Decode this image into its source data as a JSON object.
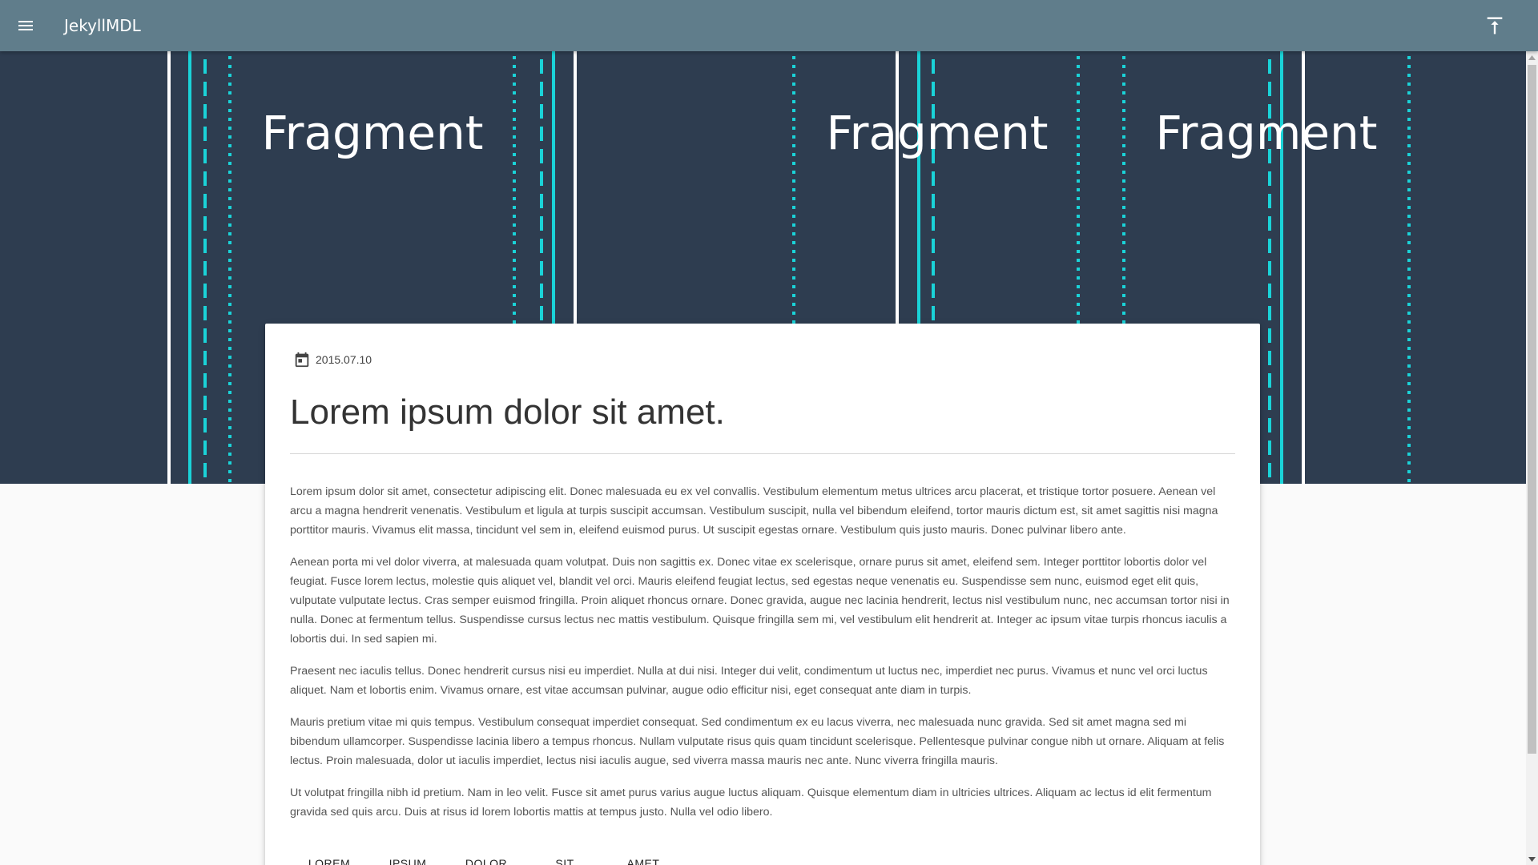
{
  "app": {
    "title": "JekyllMDL"
  },
  "icons": {
    "menu": "menu-icon",
    "scroll_top": "vertical-align-top-icon",
    "date": "calendar-icon"
  },
  "colors": {
    "appbar": "#607d8b",
    "hero_background": "#2e3d50",
    "hero_accent": "#1ad3d8"
  },
  "hero": {
    "labels": [
      "Fragment",
      "Fragment",
      "Fragment"
    ]
  },
  "post": {
    "date": "2015.07.10",
    "title": "Lorem ipsum dolor sit amet.",
    "paragraphs": [
      "Lorem ipsum dolor sit amet, consectetur adipiscing elit. Donec malesuada eu ex vel convallis. Vestibulum elementum metus ultrices arcu placerat, et tristique tortor posuere. Aenean vel arcu a magna hendrerit venenatis. Vestibulum et ligula at turpis suscipit accumsan. Vestibulum suscipit, nulla vel bibendum eleifend, tortor mauris dictum est, sit amet sagittis nisi magna porttitor mauris. Vivamus elit massa, tincidunt vel sem in, eleifend euismod purus. Ut suscipit egestas ornare. Vestibulum quis justo mauris. Donec pulvinar libero ante.",
      "Aenean porta mi vel dolor viverra, at malesuada quam volutpat. Duis non sagittis ex. Donec vitae ex scelerisque, ornare purus sit amet, eleifend sem. Integer porttitor lobortis dolor vel feugiat. Fusce lorem lectus, molestie quis aliquet vel, blandit vel orci. Mauris eleifend feugiat lectus, sed egestas neque venenatis eu. Suspendisse sem nunc, euismod eget elit quis, vulputate vulputate lectus. Cras semper euismod fringilla. Proin aliquet rhoncus ornare. Donec gravida, augue nec lacinia hendrerit, lectus nisl vestibulum nunc, nec accumsan tortor nisi in nulla. Donec at fermentum tellus. Suspendisse cursus lectus nec mattis vestibulum. Quisque fringilla sem mi, vel vestibulum elit hendrerit at. Integer ac ipsum vitae turpis rhoncus iaculis a lobortis dui. In sed sapien mi.",
      "Praesent nec iaculis tellus. Donec hendrerit cursus nisi eu imperdiet. Nulla at dui nisi. Integer dui velit, condimentum ut luctus nec, imperdiet nec purus. Vivamus et nunc vel orci luctus aliquet. Nam et lobortis enim. Vivamus ornare, est vitae accumsan pulvinar, augue odio efficitur nisi, eget consequat ante diam in turpis.",
      "Mauris pretium vitae mi quis tempus. Vestibulum consequat imperdiet consequat. Sed condimentum ex eu lacus viverra, nec malesuada nunc gravida. Sed sit amet magna sed mi bibendum ullamcorper. Suspendisse lacinia libero a tempus rhoncus. Nullam vulputate risus quis quam tincidunt scelerisque. Pellentesque pulvinar congue nibh ut ornare. Aliquam at felis lectus. Proin malesuada, dolor ut iaculis imperdiet, lectus nisi iaculis augue, sed viverra massa mauris nec ante. Nunc viverra fringilla mauris.",
      "Ut volutpat fringilla nibh id pretium. Nam in leo velit. Fusce sit amet purus varius augue luctus aliquam. Quisque elementum diam in ultricies ultrices. Aliquam ac lectus id elit fermentum gravida sed quis arcu. Duis at risus id lorem lobortis mattis at tempus justo. Nulla vel odio libero."
    ],
    "tags": [
      "LOREM",
      "IPSUM",
      "DOLOR",
      "SIT",
      "AMET"
    ]
  }
}
